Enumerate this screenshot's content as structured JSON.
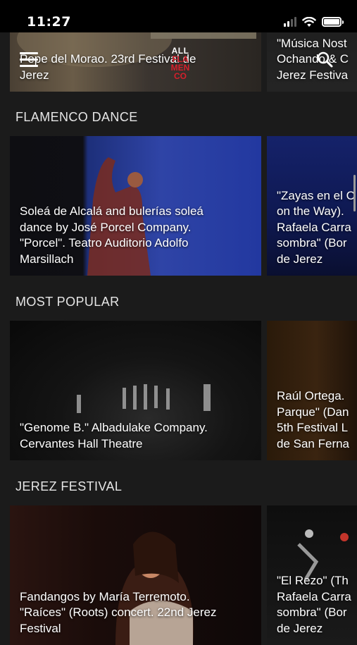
{
  "status_bar": {
    "time": "11:27",
    "signal_bars": 2,
    "battery_level": 1.0
  },
  "header": {
    "logo_line1": "ALL",
    "logo_line2": "FLA",
    "logo_line3": "MEN",
    "logo_line4": "CO"
  },
  "top_row": {
    "cards": [
      {
        "caption": "Pepe del Morao. 23rd Festival de\nJerez"
      },
      {
        "caption": "\"Música Nost\nOchando & C\nJerez Festiva"
      }
    ]
  },
  "sections": [
    {
      "title": "FLAMENCO DANCE",
      "cards": [
        {
          "caption": "Soleá de Alcalá and bulerías soleá\ndance by José Porcel Company.\n\"Porcel\". Teatro Auditorio Adolfo\nMarsillach"
        },
        {
          "caption": "\"Zayas en el C\non the Way).\nRafaela Carra\nsombra\" (Bor\nde Jerez"
        }
      ]
    },
    {
      "title": "MOST POPULAR",
      "cards": [
        {
          "caption": "\"Genome B.\" Albadulake Company.\nCervantes Hall Theatre"
        },
        {
          "caption": "Raúl Ortega.\nParque\" (Dan\n5th Festival L\nde San Ferna"
        }
      ]
    },
    {
      "title": "JEREZ FESTIVAL",
      "cards": [
        {
          "caption": "Fandangos by María Terremoto.\n\"Raíces\" (Roots) concert. 22nd Jerez\nFestival"
        },
        {
          "caption": "\"El Rezo\" (Th\nRafaela Carra\nsombra\" (Bor\nde Jerez"
        }
      ]
    }
  ]
}
